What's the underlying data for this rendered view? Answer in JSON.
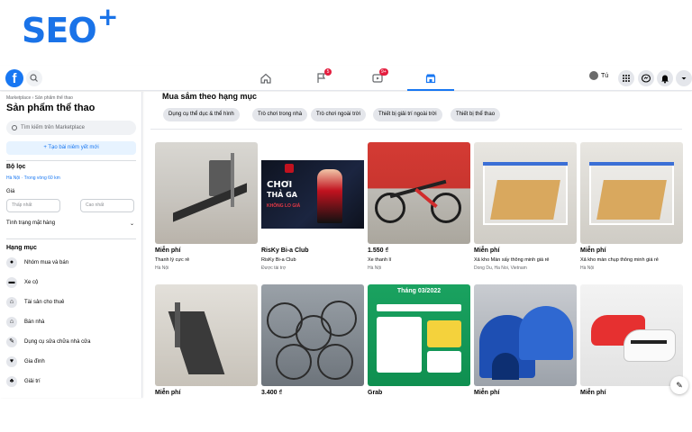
{
  "brand": {
    "logo_text": "SEO",
    "logo_plus": "+"
  },
  "topnav": {
    "facebook_glyph": "f",
    "friends_badge": "5",
    "watch_badge": "9+",
    "user_name": "Tú"
  },
  "sidebar": {
    "breadcrumb": "Marketplace › Sản phẩm thể thao",
    "title": "Sản phẩm thể thao",
    "search_placeholder": "Tìm kiếm trên Marketplace",
    "create_listing": "+ Tạo bài niêm yết mới",
    "filters_heading": "Bộ lọc",
    "location": "Hà Nội · Trong vòng 60 km",
    "price_heading": "Giá",
    "price_min_placeholder": "Thấp nhất",
    "price_max_placeholder": "Cao nhất",
    "condition_label": "Tình trạng mặt hàng",
    "categories_heading": "Hạng mục",
    "categories": [
      {
        "label": "Nhóm mua và bán",
        "icon": "group-icon"
      },
      {
        "label": "Xe cộ",
        "icon": "car-icon"
      },
      {
        "label": "Tài sản cho thuê",
        "icon": "rental-icon"
      },
      {
        "label": "Bán nhà",
        "icon": "house-icon"
      },
      {
        "label": "Dụng cụ sửa chữa nhà cửa",
        "icon": "wrench-icon"
      },
      {
        "label": "Gia đình",
        "icon": "heart-icon"
      },
      {
        "label": "Giải trí",
        "icon": "entertainment-icon"
      }
    ]
  },
  "shop": {
    "title": "Mua sắm theo hạng mục",
    "chips": [
      "Dụng cụ thể dục & thể hình",
      "Trò chơi trong nhà",
      "Trò chơi ngoài trời",
      "Thiết bị giải trí ngoài trời",
      "Thiết bị thể thao"
    ]
  },
  "listings": [
    {
      "price": "Miễn phí",
      "title": "Thanh lý cực rẻ",
      "location": "Hà Nội"
    },
    {
      "price": "RisKy Bi-a Club",
      "title": "RisKy Bi-a Club",
      "location": "Được tài trợ",
      "banner_line1": "CHƠI",
      "banner_line2": "THẢ GA",
      "banner_line3": "KHÔNG LO GIÁ"
    },
    {
      "price": "1.550 ₫",
      "title": "Xe thanh lí",
      "location": "Hà Nội"
    },
    {
      "price": "Miễn phí",
      "title": "Xả kho Màn sấy thông minh giá rẻ",
      "location": "Dong Du, Ha Noi, Vietnam"
    },
    {
      "price": "Miễn phí",
      "title": "Xả kho màn chụp thông minh giá rẻ",
      "location": "Hà Nội"
    },
    {
      "price": "Miễn phí",
      "title": "",
      "location": ""
    },
    {
      "price": "3.400 ₫",
      "title": "",
      "location": ""
    },
    {
      "price": "Grab",
      "title": "",
      "location": "",
      "promo_text": "Tháng 03/2022"
    },
    {
      "price": "Miễn phí",
      "title": "",
      "location": ""
    },
    {
      "price": "Miễn phí",
      "title": "",
      "location": ""
    }
  ],
  "colors": {
    "facebook_blue": "#1877f2",
    "badge_red": "#e41e3f",
    "seo_blue": "#1a73e8"
  }
}
